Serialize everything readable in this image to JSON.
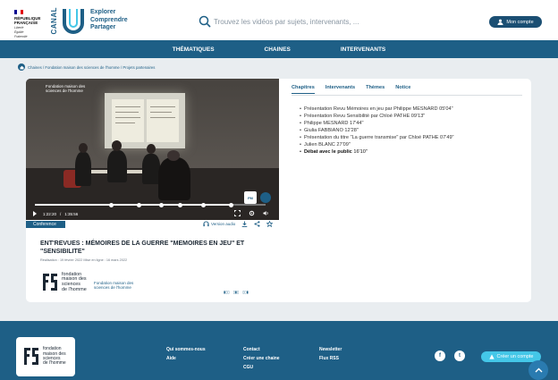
{
  "header": {
    "republic": [
      "RÉPUBLIQUE",
      "FRANÇAISE"
    ],
    "motto": [
      "Liberté",
      "Égalité",
      "Fraternité"
    ],
    "brand_word": "CANAL",
    "brand_tagline": [
      "Explorer",
      "Comprendre",
      "Partager"
    ],
    "search_placeholder": "Trouvez les vidéos par sujets, intervenants, ...",
    "account_label": "Mon compte"
  },
  "nav": [
    "THÉMATIQUES",
    "CHAINES",
    "INTERVENANTS"
  ],
  "breadcrumb": "Chaines / Fondation maison des sciences de l'homme / Projets partenaires",
  "video": {
    "overlay_brand": [
      "Fondation maison des",
      "sciences de l'homme"
    ],
    "current_time": "1:22:20",
    "duration": "1:35:56",
    "progress": 0.86,
    "chapter_marks": [
      0.33,
      0.45,
      0.55,
      0.63,
      0.73,
      0.85
    ]
  },
  "badge": "Conference",
  "actions": {
    "audio_label": "Version audio"
  },
  "title": "ENT'REVUES : MÉMOIRES DE LA GUERRE \"MEMOIRES EN JEU\" ET \"SENSIBILITE\"",
  "meta": "Réalisation : 19 février 2022  Mise en ligne : 16 mars 2022",
  "institution": {
    "name": [
      "fondation",
      "maison des",
      "sciences",
      "de l'homme"
    ],
    "link": [
      "Fondation maison des",
      "sciences de l'homme"
    ]
  },
  "pager": [
    "▮▯▯",
    "▯▮▯",
    "▯▯▮"
  ],
  "tabs": [
    "Chapitres",
    "Intervenants",
    "Thèmes",
    "Notice"
  ],
  "chapters": [
    {
      "title": "Présentation Revu Mémoires en jeu par Philippe MESNARD",
      "time": "05'04\""
    },
    {
      "title": "Présentation Revu Sensibilité par Chloé PATHE",
      "time": "09'13\""
    },
    {
      "title": "Philippe MESNARD",
      "time": "17'44\""
    },
    {
      "title": "Giulia FABBIANO",
      "time": "12'28\""
    },
    {
      "title": "Présentation du titre \"La guerre transmise\" par Chloé PATHE",
      "time": "07'49\""
    },
    {
      "title": "Julien BLANC",
      "time": "27'09\""
    },
    {
      "title": "Débat avec le public",
      "time": "16'10\""
    }
  ],
  "footer": {
    "col1": [
      "Qui sommes-nous",
      "Aide"
    ],
    "col2": [
      "Contact",
      "Créer une chaine",
      "CGU"
    ],
    "col3": [
      "Newsletter",
      "Flux RSS"
    ],
    "social": [
      "f",
      "t"
    ],
    "create_account": "Créer un compte"
  }
}
